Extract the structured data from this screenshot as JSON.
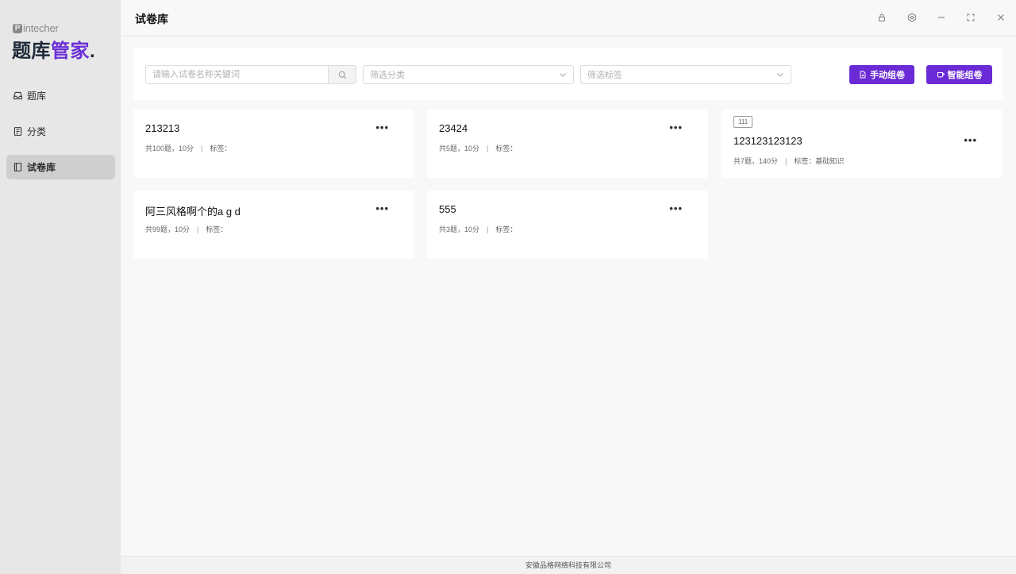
{
  "brand": {
    "small_label": "intecher",
    "small_logo_letter": "P",
    "title_part1": "题库",
    "title_part2": "管家",
    "title_part3": "."
  },
  "sidebar": {
    "items": [
      {
        "label": "题库",
        "icon": "inbox-icon",
        "active": false
      },
      {
        "label": "分类",
        "icon": "document-list-icon",
        "active": false
      },
      {
        "label": "试卷库",
        "icon": "book-icon",
        "active": true
      }
    ]
  },
  "header": {
    "title": "试卷库",
    "controls": [
      "lock-icon",
      "settings-icon",
      "minimize-icon",
      "fullscreen-icon",
      "close-icon"
    ]
  },
  "toolbar": {
    "search_placeholder": "请输入试卷名称关键词",
    "category_placeholder": "筛选分类",
    "tag_placeholder": "筛选标签",
    "manual_button": "手动组卷",
    "smart_button": "智能组卷"
  },
  "cards": [
    {
      "title": "213213",
      "count": "共100题，10分",
      "sep": "|",
      "tags": "标签：",
      "badge": ""
    },
    {
      "title": "23424",
      "count": "共5题，10分",
      "sep": "|",
      "tags": "标签：",
      "badge": ""
    },
    {
      "title": "123123123123",
      "count": "共7题，140分",
      "sep": "|",
      "tags": "标签：基础知识",
      "badge": "111"
    },
    {
      "title": "阿三风格啊个的a g d",
      "count": "共99题，10分",
      "sep": "|",
      "tags": "标签：",
      "badge": ""
    },
    {
      "title": "555",
      "count": "共3题，10分",
      "sep": "|",
      "tags": "标签：",
      "badge": ""
    }
  ],
  "card_more_label": "•••",
  "footer": {
    "text": "安徽品格网络科技有限公司"
  },
  "colors": {
    "accent": "#6a2ad6",
    "sidebar_bg": "#e7e7e7",
    "main_bg": "#f8f8f8"
  }
}
